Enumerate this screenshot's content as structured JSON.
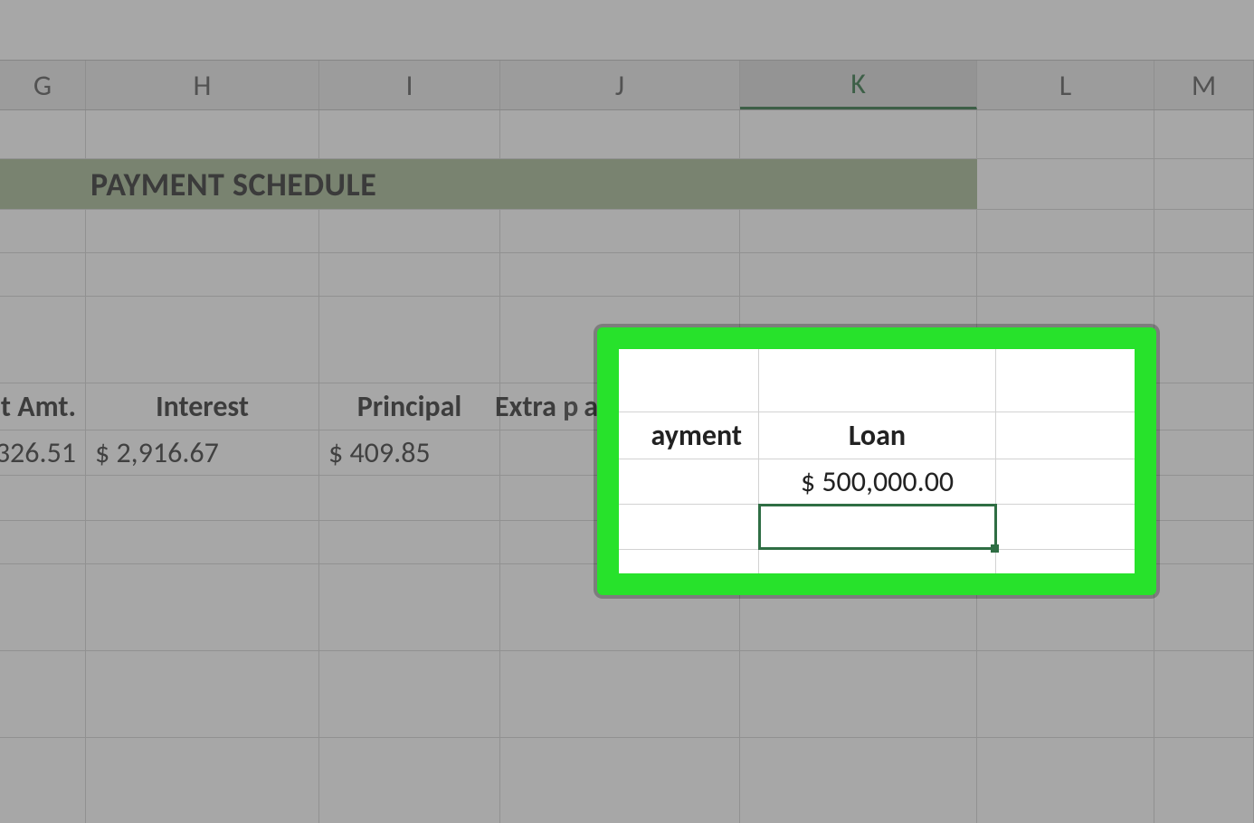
{
  "columns": {
    "G": "G",
    "H": "H",
    "I": "I",
    "J": "J",
    "K": "K",
    "L": "L",
    "M": "M"
  },
  "selected_column": "K",
  "title": "PAYMENT SCHEDULE",
  "labels": {
    "payment_amt_partial": "nt Amt.",
    "interest": "Interest",
    "principal": "Principal",
    "extra_payment": "Extra payment",
    "loan": "Loan"
  },
  "data_row": {
    "payment_amt_partial": "326.51",
    "interest": "$   2,916.67",
    "principal": "$ 409.85",
    "extra_payment": "",
    "loan": "$ 500,000.00"
  },
  "highlight": {
    "extra_payment_label_fragment": "ayment",
    "loan_label": "Loan",
    "loan_value": "$ 500,000.00",
    "selected_cell_value": ""
  }
}
